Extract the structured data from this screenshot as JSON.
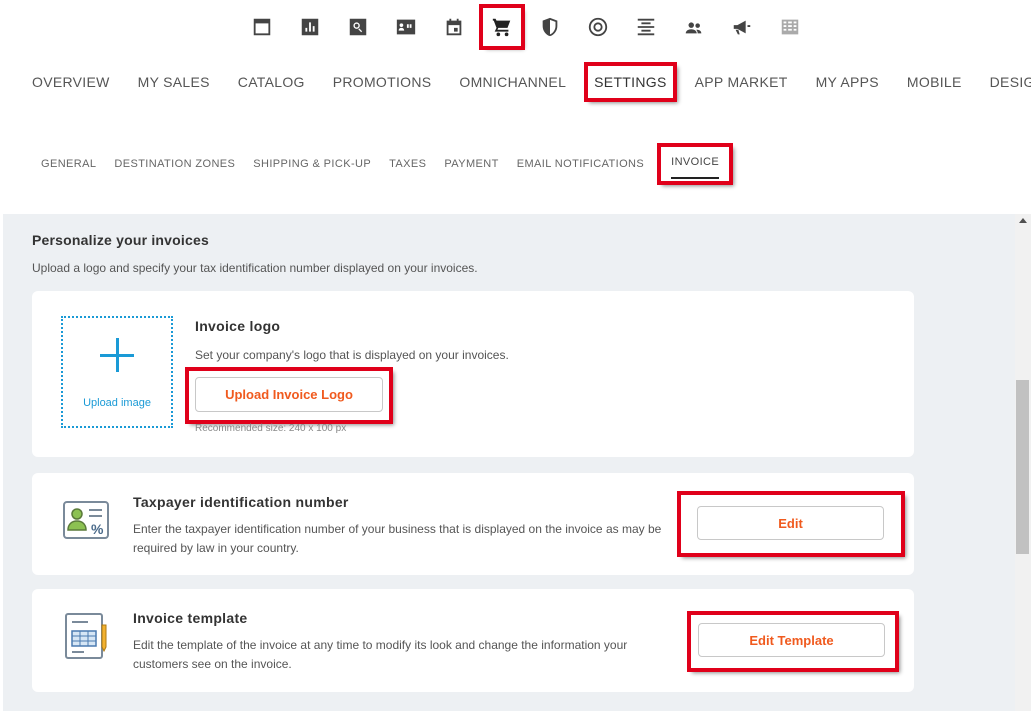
{
  "top_icons": [
    {
      "name": "storefront-window-icon",
      "active": false
    },
    {
      "name": "bar-chart-icon",
      "active": false
    },
    {
      "name": "search-icon",
      "active": false
    },
    {
      "name": "contact-card-icon",
      "active": false
    },
    {
      "name": "calendar-icon",
      "active": false
    },
    {
      "name": "shopping-cart-icon",
      "active": true
    },
    {
      "name": "shield-icon",
      "active": false
    },
    {
      "name": "target-radar-icon",
      "active": false
    },
    {
      "name": "align-center-icon",
      "active": false
    },
    {
      "name": "users-icon",
      "active": false
    },
    {
      "name": "megaphone-icon",
      "active": false
    },
    {
      "name": "building-icon",
      "active": false
    }
  ],
  "main_nav": {
    "items": [
      "OVERVIEW",
      "MY SALES",
      "CATALOG",
      "PROMOTIONS",
      "OMNICHANNEL",
      "SETTINGS",
      "APP MARKET",
      "MY APPS",
      "MOBILE",
      "DESIGN"
    ],
    "active": "SETTINGS"
  },
  "sub_nav": {
    "items": [
      "GENERAL",
      "DESTINATION ZONES",
      "SHIPPING & PICK-UP",
      "TAXES",
      "PAYMENT",
      "EMAIL NOTIFICATIONS",
      "INVOICE"
    ],
    "active": "INVOICE"
  },
  "page": {
    "title": "Personalize your invoices",
    "description": "Upload a logo and specify your tax identification number displayed on your invoices."
  },
  "logo_card": {
    "upload_label": "Upload image",
    "title": "Invoice logo",
    "description": "Set your company's logo that is displayed on your invoices.",
    "button": "Upload Invoice Logo",
    "note": "Recommended size: 240 x 100 px"
  },
  "tax_card": {
    "title": "Taxpayer identification number",
    "description": "Enter the taxpayer identification number of your business that is displayed on the invoice as may be required by law in your country.",
    "button": "Edit"
  },
  "template_card": {
    "title": "Invoice template",
    "description": "Edit the template of the invoice at any time to modify its look and change the information your customers see on the invoice.",
    "button": "Edit Template"
  },
  "colors": {
    "accent": "#f05a1e",
    "link_blue": "#1a9ad6",
    "highlight_red": "#e0001a",
    "content_bg": "#edf0f3"
  }
}
